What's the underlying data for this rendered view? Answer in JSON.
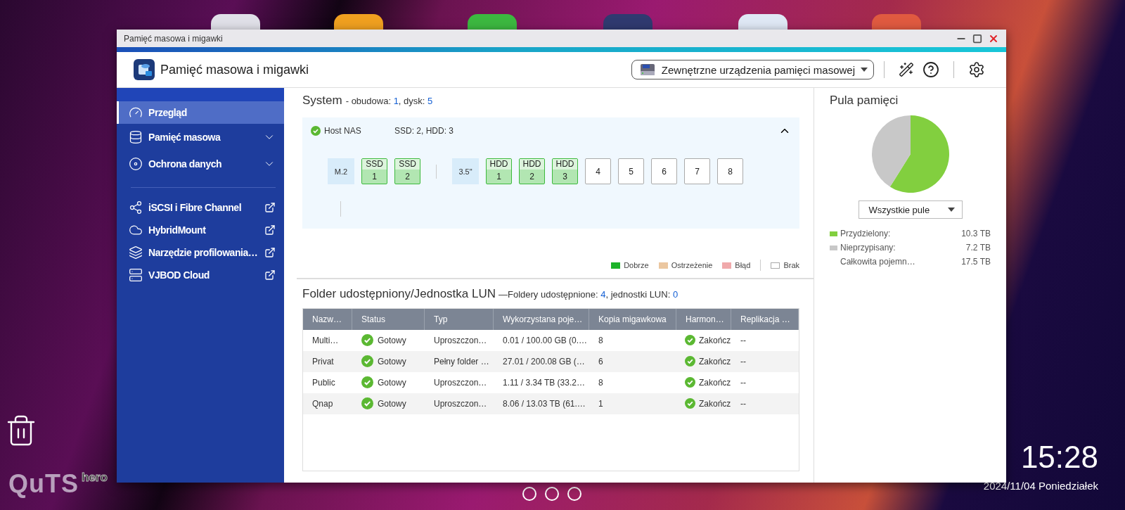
{
  "desktop": {
    "logo": {
      "main": "QuTS",
      "sub": "hero"
    },
    "clock": {
      "time": "15:28",
      "date": "2024/11/04 Poniedziałek"
    }
  },
  "window": {
    "title": "Pamięć masowa i migawki"
  },
  "header": {
    "app_title": "Pamięć masowa i migawki",
    "device_dropdown": "Zewnętrzne urządzenia pamięci masowej"
  },
  "sidebar": {
    "items": [
      {
        "label": "Przegląd",
        "kind": "page",
        "selected": true
      },
      {
        "label": "Pamięć masowa",
        "kind": "group",
        "selected": false,
        "expanded": false
      },
      {
        "label": "Ochrona danych",
        "kind": "group",
        "selected": false,
        "expanded": false
      },
      {
        "label": "iSCSI i Fibre Channel",
        "kind": "external",
        "selected": false
      },
      {
        "label": "HybridMount",
        "kind": "external",
        "selected": false
      },
      {
        "label": "Narzędzie profilowania…",
        "kind": "external",
        "selected": false
      },
      {
        "label": "VJBOD Cloud",
        "kind": "external",
        "selected": false
      }
    ]
  },
  "system": {
    "title": "System",
    "summary_prefix": "- obudowa: ",
    "enclosures": "1",
    "summary_mid": ", dysk: ",
    "disks": "5",
    "host": {
      "name": "Host NAS",
      "healthy": true,
      "disk_summary": "SSD: 2, HDD: 3",
      "expanded": true
    },
    "bay_groups": [
      {
        "label": "M.2",
        "slots": [
          {
            "type": "SSD",
            "number": "1",
            "color": "#b2e6b2"
          },
          {
            "type": "SSD",
            "number": "2",
            "color": "#b2e6b2"
          }
        ]
      },
      {
        "label": "3.5\"",
        "slots": [
          {
            "type": "HDD",
            "number": "1",
            "color": "#b2e6b2"
          },
          {
            "type": "HDD",
            "number": "2",
            "color": "#b2e6b2"
          },
          {
            "type": "HDD",
            "number": "3",
            "color": "#b2e6b2"
          },
          {
            "number": "4",
            "color": "#ffffff"
          },
          {
            "number": "5",
            "color": "#ffffff"
          },
          {
            "number": "6",
            "color": "#ffffff"
          },
          {
            "number": "7",
            "color": "#ffffff"
          },
          {
            "number": "8",
            "color": "#ffffff"
          }
        ]
      }
    ],
    "legend": [
      {
        "label": "Dobrze",
        "color": "#1db32a"
      },
      {
        "label": "Ostrzeżenie",
        "color": "#ebc7a0"
      },
      {
        "label": "Błąd",
        "color": "#f0a9ab"
      },
      {
        "label": "Brak",
        "color": "#ffffff"
      }
    ]
  },
  "shared": {
    "title": "Folder udostępniony/Jednostka LUN",
    "summary_prefix": "—Foldery udostępnione: ",
    "folders": "4",
    "summary_mid": ", jednostki LUN: ",
    "luns": "0",
    "table": {
      "columns": [
        "Nazw…",
        "Status",
        "Typ",
        "Wykorzystana poje…",
        "Kopia migawkowa",
        "Harmon…",
        "Replikacja …"
      ],
      "rows": [
        {
          "name": "Multi…",
          "status": "Gotowy",
          "type": "Uproszczon…",
          "used": "0.01 / 100.00 GB (0.…",
          "snapshots": "8",
          "schedule": "Zakończ",
          "replication": "--"
        },
        {
          "name": "Privat",
          "status": "Gotowy",
          "type": "Pełny folder …",
          "used": "27.01 / 200.08 GB (…",
          "snapshots": "6",
          "schedule": "Zakończ",
          "replication": "--"
        },
        {
          "name": "Public",
          "status": "Gotowy",
          "type": "Uproszczon…",
          "used": "1.11 / 3.34 TB (33.2…",
          "snapshots": "8",
          "schedule": "Zakończ",
          "replication": "--"
        },
        {
          "name": "Qnap",
          "status": "Gotowy",
          "type": "Uproszczon…",
          "used": "8.06 / 13.03 TB (61.…",
          "snapshots": "1",
          "schedule": "Zakończ",
          "replication": "--"
        }
      ]
    }
  },
  "pool": {
    "title": "Pula pamięci",
    "chart_data": {
      "type": "pie",
      "values": [
        58.9,
        41.1
      ]
    },
    "selector": "Wszystkie pule",
    "stats": [
      {
        "label": "Przydzielony:",
        "value": "10.3 TB",
        "color": "#82cf3f"
      },
      {
        "label": "Nieprzypisany:",
        "value": "7.2 TB",
        "color": "#c8c8c8"
      },
      {
        "label": "Całkowita pojemn…",
        "value": "17.5 TB"
      }
    ]
  }
}
